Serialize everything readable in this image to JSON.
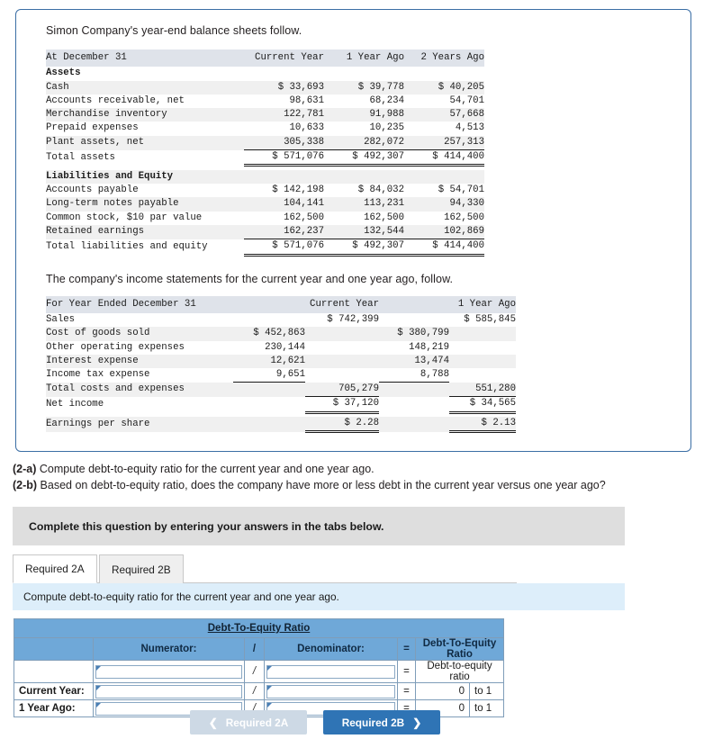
{
  "intro": {
    "balance_sheet_lead": "Simon Company's year-end balance sheets follow.",
    "income_lead": "The company's income statements for the current year and one year ago, follow."
  },
  "balance_sheet": {
    "header": [
      "At December 31",
      "Current Year",
      "1 Year Ago",
      "2 Years Ago"
    ],
    "sections": [
      {
        "section_title": "Assets",
        "rows": [
          {
            "label": "Cash",
            "values": [
              "$ 33,693",
              "$ 39,778",
              "$ 40,205"
            ]
          },
          {
            "label": "Accounts receivable, net",
            "values": [
              "98,631",
              "68,234",
              "54,701"
            ]
          },
          {
            "label": "Merchandise inventory",
            "values": [
              "122,781",
              "91,988",
              "57,668"
            ]
          },
          {
            "label": "Prepaid expenses",
            "values": [
              "10,633",
              "10,235",
              "4,513"
            ]
          },
          {
            "label": "Plant assets, net",
            "values": [
              "305,338",
              "282,072",
              "257,313"
            ]
          }
        ],
        "total": {
          "label": "Total assets",
          "values": [
            "$ 571,076",
            "$ 492,307",
            "$ 414,400"
          ]
        }
      },
      {
        "section_title": "Liabilities and Equity",
        "rows": [
          {
            "label": "Accounts payable",
            "values": [
              "$ 142,198",
              "$ 84,032",
              "$ 54,701"
            ]
          },
          {
            "label": "Long-term notes payable",
            "values": [
              "104,141",
              "113,231",
              "94,330"
            ]
          },
          {
            "label": "Common stock, $10 par value",
            "values": [
              "162,500",
              "162,500",
              "162,500"
            ]
          },
          {
            "label": "Retained earnings",
            "values": [
              "162,237",
              "132,544",
              "102,869"
            ]
          }
        ],
        "total": {
          "label": "Total liabilities and equity",
          "values": [
            "$ 571,076",
            "$ 492,307",
            "$ 414,400"
          ]
        }
      }
    ]
  },
  "income_statement": {
    "header": [
      "For Year Ended December 31",
      "Current Year",
      "1 Year Ago"
    ],
    "rows": [
      {
        "label": "Sales",
        "a": "",
        "b": "$ 742,399",
        "c": "",
        "d": "$ 585,845"
      },
      {
        "label": "Cost of goods sold",
        "a": "$ 452,863",
        "b": "",
        "c": "$ 380,799",
        "d": ""
      },
      {
        "label": "Other operating expenses",
        "a": "230,144",
        "b": "",
        "c": "148,219",
        "d": ""
      },
      {
        "label": "Interest expense",
        "a": "12,621",
        "b": "",
        "c": "13,474",
        "d": ""
      },
      {
        "label": "Income tax expense",
        "a": "9,651",
        "b": "",
        "c": "8,788",
        "d": ""
      },
      {
        "label": "Total costs and expenses",
        "a": "",
        "b": "705,279",
        "c": "",
        "d": "551,280"
      },
      {
        "label": "Net income",
        "a": "",
        "b": "$ 37,120",
        "c": "",
        "d": "$ 34,565"
      },
      {
        "label": "Earnings per share",
        "a": "",
        "b": "$ 2.28",
        "c": "",
        "d": "$ 2.13"
      }
    ]
  },
  "questions": {
    "q2a_tag": "(2-a)",
    "q2a_text": " Compute debt-to-equity ratio for the current year and one year ago.",
    "q2b_tag": "(2-b)",
    "q2b_text": " Based on debt-to-equity ratio, does the company have more or less debt in the current year versus one year ago?"
  },
  "banner": {
    "text": "Complete this question by entering your answers in the tabs below."
  },
  "tabs": [
    {
      "label": "Required 2A",
      "active": true
    },
    {
      "label": "Required 2B",
      "active": false
    }
  ],
  "sub_instruction": {
    "text": "Compute debt-to-equity ratio for the current year and one year ago."
  },
  "answer_table": {
    "title": "Debt-To-Equity Ratio",
    "columns": {
      "blank": "",
      "numerator": "Numerator:",
      "slash": "/",
      "denominator": "Denominator:",
      "equals": "=",
      "result": "Debt-To-Equity Ratio"
    },
    "rows": [
      {
        "label": "",
        "numerator_value": "",
        "slash": "/",
        "denominator_value": "",
        "equals": "=",
        "result": "Debt-to-equity ratio",
        "suffix": ""
      },
      {
        "label": "Current Year:",
        "numerator_value": "",
        "slash": "/",
        "denominator_value": "",
        "equals": "=",
        "result": "0",
        "suffix": "to 1"
      },
      {
        "label": "1 Year Ago:",
        "numerator_value": "",
        "slash": "/",
        "denominator_value": "",
        "equals": "=",
        "result": "0",
        "suffix": "to 1"
      }
    ]
  },
  "nav": {
    "prev_label": "Required 2A",
    "prev_icon": "chevron-left",
    "next_label": "Required 2B",
    "next_icon": "chevron-right"
  },
  "colors": {
    "card_border": "#3b6ea5",
    "table_header_bg": "#dfe3ea",
    "zebra": "#f0f0f0",
    "banner_gray": "#dedede",
    "instruction_blue": "#ddeefa",
    "grid_header_blue": "#6fa8d8",
    "grid_border": "#7f9db9",
    "btn_next_blue": "#2f74b5",
    "btn_prev_gray": "#cdd9e5"
  }
}
